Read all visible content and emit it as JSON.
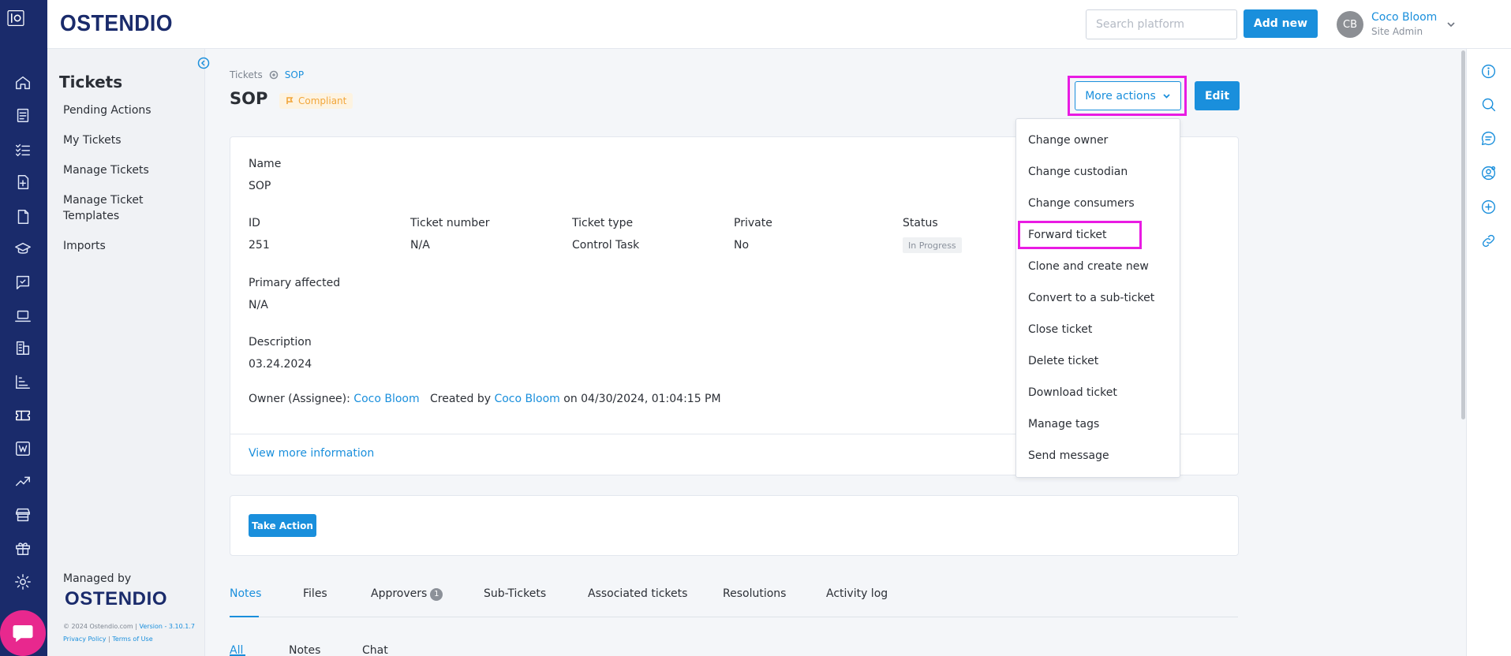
{
  "app": {
    "brand": "OSTENDIO",
    "search_placeholder": "Search platform",
    "add_new_label": "Add new",
    "user": {
      "initials": "CB",
      "name": "Coco Bloom",
      "role": "Site Admin"
    }
  },
  "rail_icons": [
    "home-icon",
    "clipboard-icon",
    "checklist-icon",
    "file-plus-icon",
    "document-icon",
    "graduation-cap-icon",
    "feedback-icon",
    "laptop-icon",
    "buildings-icon",
    "bar-chart-icon",
    "ticket-icon",
    "wiki-icon",
    "trend-icon",
    "store-icon",
    "gift-icon",
    "settings-icon"
  ],
  "sidebar": {
    "title": "Tickets",
    "items": [
      {
        "label": "Pending Actions"
      },
      {
        "label": "My Tickets"
      },
      {
        "label": "Manage Tickets"
      },
      {
        "label": "Manage Ticket Templates"
      },
      {
        "label": "Imports"
      }
    ],
    "managed_by": "Managed by",
    "managed_logo": "OSTENDIO",
    "footer_copy": "© 2024 Ostendio.com |",
    "footer_version": "Version - 3.10.1.7",
    "footer_privacy": "Privacy Policy",
    "footer_sep": "|",
    "footer_terms": "Terms of Use"
  },
  "breadcrumb": {
    "root": "Tickets",
    "current": "SOP"
  },
  "page": {
    "title": "SOP",
    "badge": "Compliant",
    "more_actions_label": "More actions",
    "edit_label": "Edit"
  },
  "details": {
    "name_label": "Name",
    "name_value": "SOP",
    "id_label": "ID",
    "id_value": "251",
    "ticket_number_label": "Ticket number",
    "ticket_number_value": "N/A",
    "ticket_type_label": "Ticket type",
    "ticket_type_value": "Control Task",
    "private_label": "Private",
    "private_value": "No",
    "status_label": "Status",
    "status_value": "In Progress",
    "primary_affected_label": "Primary affected",
    "primary_affected_value": "N/A",
    "description_label": "Description",
    "description_value": "03.24.2024",
    "owner_label": "Owner (Assignee):",
    "owner_name": "Coco Bloom",
    "created_by_label": "Created by",
    "created_by_name": "Coco Bloom",
    "created_on": "on 04/30/2024, 01:04:15 PM",
    "view_more": "View more information"
  },
  "take_action_label": "Take Action",
  "tabs": [
    {
      "label": "Notes"
    },
    {
      "label": "Files"
    },
    {
      "label": "Approvers",
      "count": "1"
    },
    {
      "label": "Sub-Tickets"
    },
    {
      "label": "Associated tickets"
    },
    {
      "label": "Resolutions"
    },
    {
      "label": "Activity log"
    }
  ],
  "subtabs": [
    {
      "label": "All"
    },
    {
      "label": "Notes"
    },
    {
      "label": "Chat"
    }
  ],
  "menu": {
    "items": [
      {
        "label": "Change owner"
      },
      {
        "label": "Change custodian"
      },
      {
        "label": "Change consumers"
      },
      {
        "label": "Forward ticket"
      },
      {
        "label": "Clone and create new"
      },
      {
        "label": "Convert to a sub-ticket"
      },
      {
        "label": "Close ticket"
      },
      {
        "label": "Delete ticket"
      },
      {
        "label": "Download ticket"
      },
      {
        "label": "Manage tags"
      },
      {
        "label": "Send message"
      }
    ]
  },
  "right_rail_icons": [
    "info-icon",
    "search-icon",
    "comment-icon",
    "user-settings-icon",
    "plus-circle-icon",
    "link-icon"
  ],
  "colors": {
    "brand": "#1a2b6b",
    "accent": "#1a8fdc",
    "highlight": "#e91be3",
    "chat": "#e8288e",
    "badge": "#f2a63a"
  }
}
